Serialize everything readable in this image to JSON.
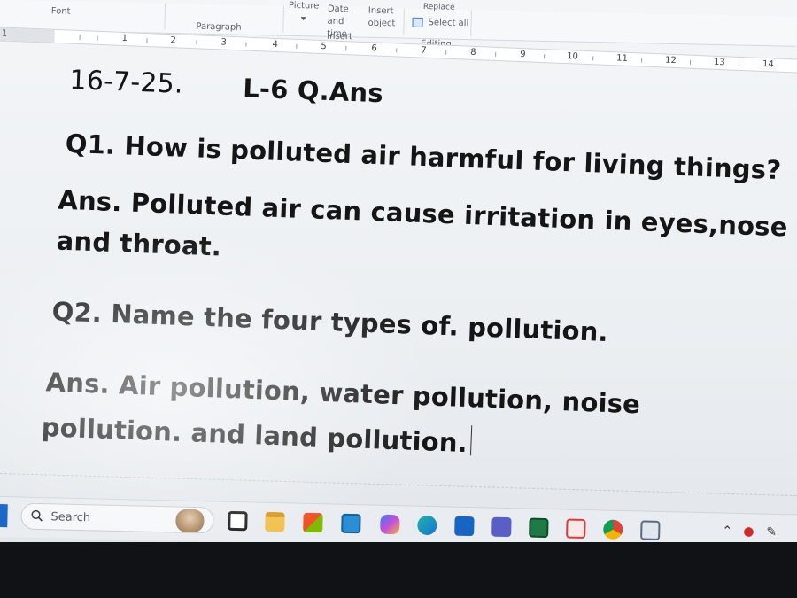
{
  "ribbon": {
    "font_label": "Font",
    "paragraph_label": "Paragraph",
    "picture_label": "Picture",
    "date_time_label": "Date and time",
    "insert_object_label": "Insert object",
    "insert_group_label": "Insert",
    "replace_label": "Replace",
    "select_all_label": "Select all",
    "editing_label": "Editing"
  },
  "ruler": {
    "numbers": [
      "1",
      "1",
      "2",
      "3",
      "4",
      "5",
      "6",
      "7",
      "8",
      "9",
      "10",
      "11",
      "12",
      "13",
      "14"
    ]
  },
  "document": {
    "date": "16-7-25.",
    "title": "L-6 Q.Ans",
    "q1": "Q1. How is polluted air harmful for living things?",
    "a1_line1": "Ans. Polluted air can cause irritation in eyes,nose",
    "a1_line2": "and throat.",
    "q2": "Q2. Name the four types of. pollution.",
    "a2_line1": "Ans. Air pollution, water pollution, noise",
    "a2_line2": "pollution. and land pollution."
  },
  "taskbar": {
    "search_label": "Search",
    "apps": [
      "file-explorer-icon",
      "folder-icon",
      "microsoft-store-icon",
      "snipping-tool-icon",
      "copilot-icon",
      "edge-icon",
      "outlook-icon",
      "teams-icon",
      "excel-icon",
      "paint-icon",
      "chrome-icon",
      "notepad-icon"
    ]
  },
  "colors": {
    "accent": "#1b66c9",
    "text": "#151515",
    "taskbar_bg": "#e9ecf0"
  }
}
